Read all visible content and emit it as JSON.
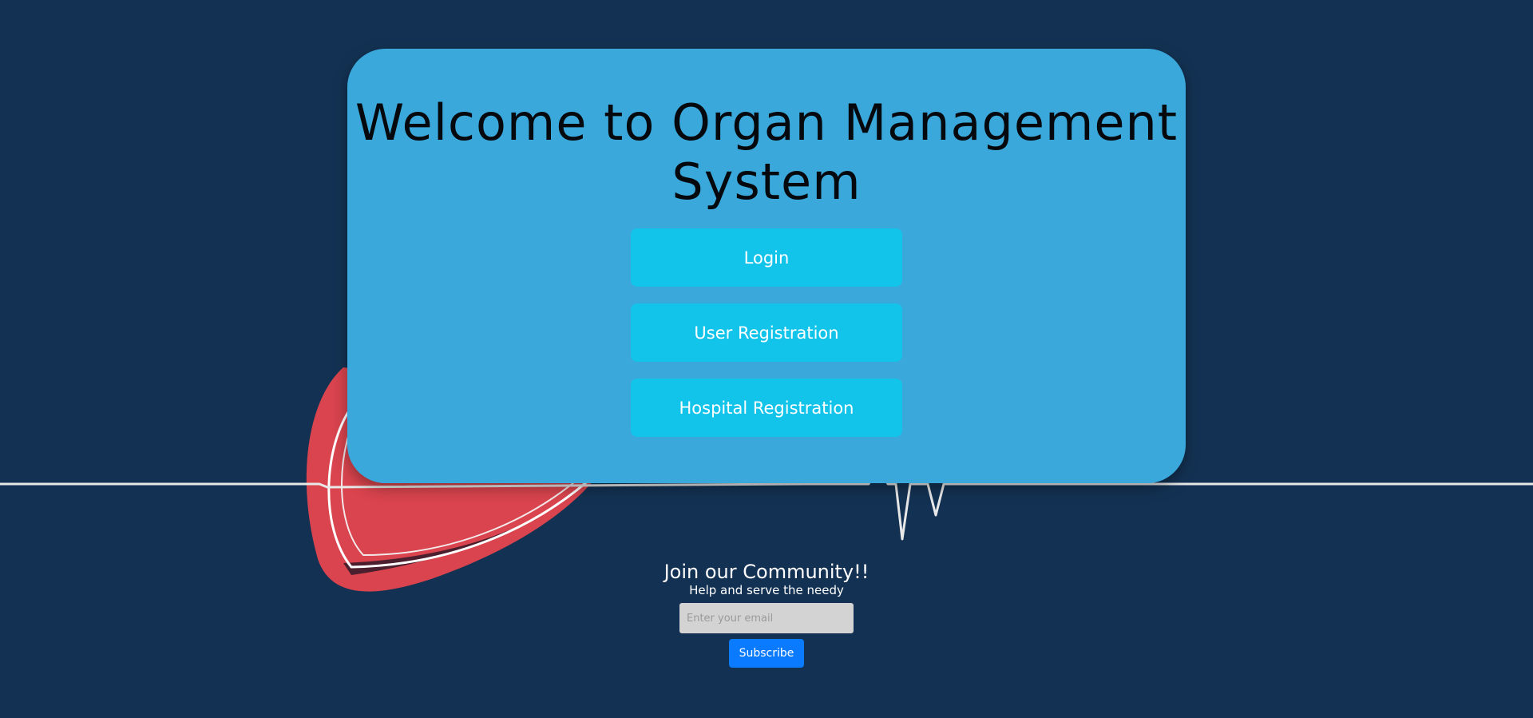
{
  "hero": {
    "title": "Welcome to Organ Management System",
    "login_label": "Login",
    "user_registration_label": "User Registration",
    "hospital_registration_label": "Hospital Registration"
  },
  "community": {
    "title": "Join our Community!!",
    "subtitle": "Help and serve the needy",
    "email_placeholder": "Enter your email",
    "email_value": "",
    "subscribe_label": "Subscribe"
  },
  "colors": {
    "background": "#133253",
    "card": "#3aa8db",
    "hero_button": "#12c3ea",
    "subscribe_button": "#0a7bff",
    "heart": "#d9444e"
  },
  "icons": {
    "background_art": "heart-ekg-illustration"
  }
}
